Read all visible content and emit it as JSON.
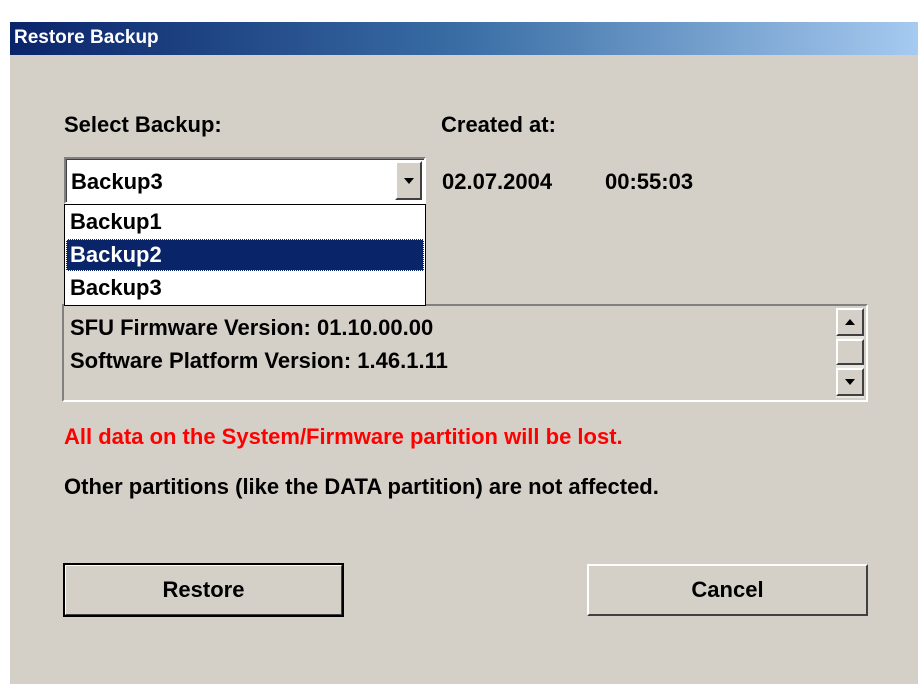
{
  "window": {
    "title": "Restore Backup"
  },
  "labels": {
    "select_backup": "Select Backup:",
    "created_at": "Created at:"
  },
  "backup_select": {
    "selected_value": "Backup3",
    "options": [
      "Backup1",
      "Backup2",
      "Backup3"
    ],
    "highlighted_option": "Backup2"
  },
  "created": {
    "date": "02.07.2004",
    "time": "00:55:03"
  },
  "info": {
    "lines": [
      "SFU Firmware Version: 01.10.00.00",
      "Software Platform Version: 1.46.1.11"
    ]
  },
  "messages": {
    "warning": "All data on the System/Firmware partition will be lost.",
    "note": "Other partitions (like the DATA partition) are not affected."
  },
  "buttons": {
    "restore": "Restore",
    "cancel": "Cancel"
  },
  "colors": {
    "title_gradient_start": "#0a246a",
    "title_gradient_end": "#a6caf0",
    "dialog_face": "#d4d0c8",
    "warning_text": "#ff0000",
    "selection_bg": "#0a246a"
  },
  "icons": {
    "combo_arrow": "chevron-down-icon",
    "scroll_up": "scroll-up-arrow-icon",
    "scroll_down": "scroll-down-arrow-icon"
  }
}
